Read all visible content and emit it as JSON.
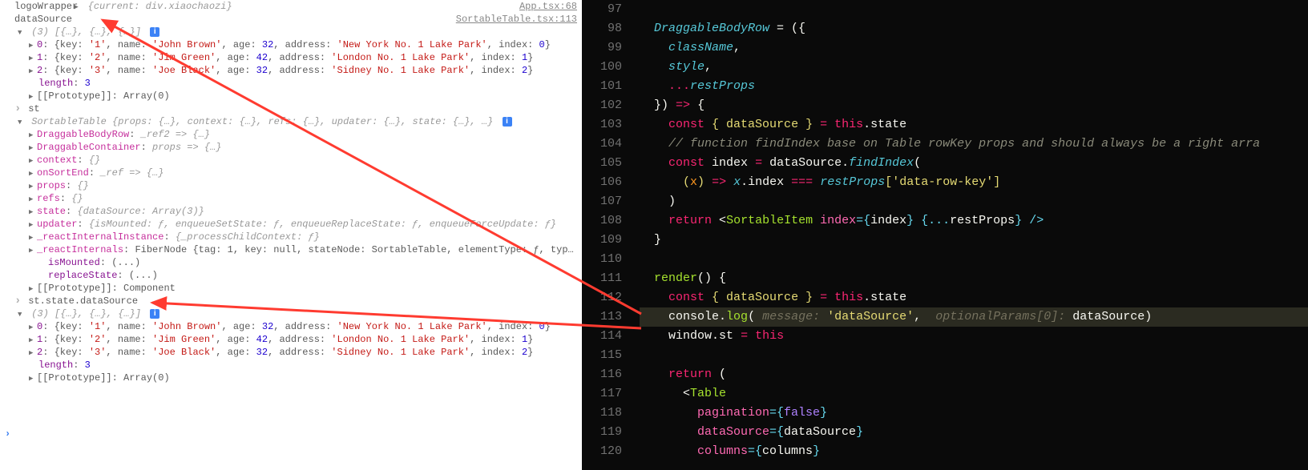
{
  "console": {
    "src1": "App.tsx:68",
    "src2": "SortableTable.tsx:113",
    "logoWrapper": {
      "label": "logoWrapper",
      "preview": "{current: div.xiaochaozi}"
    },
    "dataSourceLabel": "dataSource",
    "arrHeader": "(3) [{…}, {…}, {…}]",
    "arr": [
      {
        "idx": "0",
        "key": "'1'",
        "name": "'John Brown'",
        "age": "32",
        "address": "'New York No. 1 Lake Park'",
        "index": "0"
      },
      {
        "idx": "1",
        "key": "'2'",
        "name": "'Jim Green'",
        "age": "42",
        "address": "'London No. 1 Lake Park'",
        "index": "1"
      },
      {
        "idx": "2",
        "key": "'3'",
        "name": "'Joe Black'",
        "age": "32",
        "address": "'Sidney No. 1 Lake Park'",
        "index": "2"
      }
    ],
    "length": {
      "k": "length",
      "v": "3"
    },
    "proto": {
      "k": "[[Prototype]]",
      "v": "Array(0)"
    },
    "stLabel": "st",
    "sortable": {
      "header": "SortableTable {props: {…}, context: {…}, refs: {…}, updater: {…}, state: {…}, …}",
      "items": [
        {
          "k": "DraggableBodyRow",
          "v": "_ref2 => {…}"
        },
        {
          "k": "DraggableContainer",
          "v": "props => {…}"
        },
        {
          "k": "context",
          "v": "{}"
        },
        {
          "k": "onSortEnd",
          "v": "_ref => {…}"
        },
        {
          "k": "props",
          "v": "{}"
        },
        {
          "k": "refs",
          "v": "{}"
        },
        {
          "k": "state",
          "v": "{dataSource: Array(3)}"
        },
        {
          "k": "updater",
          "v": "{isMounted: ƒ, enqueueSetState: ƒ, enqueueReplaceState: ƒ, enqueueForceUpdate: ƒ}"
        },
        {
          "k": "_reactInternalInstance",
          "v": "{_processChildContext: ƒ}"
        }
      ],
      "reactInternals": {
        "k": "_reactInternals",
        "text": "FiberNode {tag: 1, key: null, stateNode: SortableTable, elementType: ƒ, typ…"
      },
      "tail": [
        {
          "k": "isMounted",
          "v": "(...)"
        },
        {
          "k": "replaceState",
          "v": "(...)"
        }
      ],
      "proto": {
        "k": "[[Prototype]]",
        "v": "Component"
      }
    },
    "stState": "st.state.dataSource"
  },
  "editor": {
    "lines": [
      "97",
      "98",
      "99",
      "100",
      "101",
      "102",
      "103",
      "104",
      "105",
      "106",
      "107",
      "108",
      "109",
      "110",
      "111",
      "112",
      "113",
      "114",
      "115",
      "116",
      "117",
      "118",
      "119",
      "120"
    ],
    "code": {
      "l98a": "DraggableBodyRow",
      "l98b": " = ({",
      "l99": "className",
      "l100": "style",
      "l101": "restProps",
      "l101a": "...",
      "l102": "}) => {",
      "l103a": "const",
      "l103b": "{ dataSource }",
      "l103c": "=",
      "l103d": "this",
      "l103e": ".state",
      "l104": "// function findIndex base on Table rowKey props and should always be a right arra",
      "l105a": "const",
      "l105b": "index",
      "l105c": "=",
      "l105d": "dataSource",
      "l105e": ".",
      "l105f": "findIndex",
      "l105g": "(",
      "l106a": "(",
      "l106b": "x",
      "l106c": ")",
      "l106d": "=>",
      "l106e": "x",
      "l106f": ".index",
      "l106g": "===",
      "l106h": "restProps",
      "l106i": "[",
      "l106j": "'data-row-key'",
      "l106k": "]",
      "l107": ")",
      "l108a": "return",
      "l108b": "<",
      "l108c": "SortableItem",
      "l108d": "index",
      "l108e": "={",
      "l108f": "index",
      "l108g": "} {...",
      "l108h": "restProps",
      "l108i": "} />",
      "l109": "}",
      "l111a": "render",
      "l111b": "() {",
      "l112a": "const",
      "l112b": "{ dataSource }",
      "l112c": "=",
      "l112d": "this",
      "l112e": ".state",
      "l113a": "console",
      "l113b": ".",
      "l113c": "log",
      "l113d": "(",
      "l113gh1": "message:",
      "l113e": "'dataSource'",
      "l113f": ",",
      "l113gh2": "optionalParams[0]:",
      "l113g": "dataSource",
      "l113h": ")",
      "l114a": "window",
      "l114b": ".st",
      "l114c": "=",
      "l114d": "this",
      "l116": "return (",
      "l117a": "<",
      "l117b": "Table",
      "l118a": "pagination",
      "l118b": "={",
      "l118c": "false",
      "l118d": "}",
      "l119a": "dataSource",
      "l119b": "={",
      "l119c": "dataSource",
      "l119d": "}",
      "l120a": "columns",
      "l120b": "={",
      "l120c": "columns",
      "l120d": "}"
    }
  }
}
